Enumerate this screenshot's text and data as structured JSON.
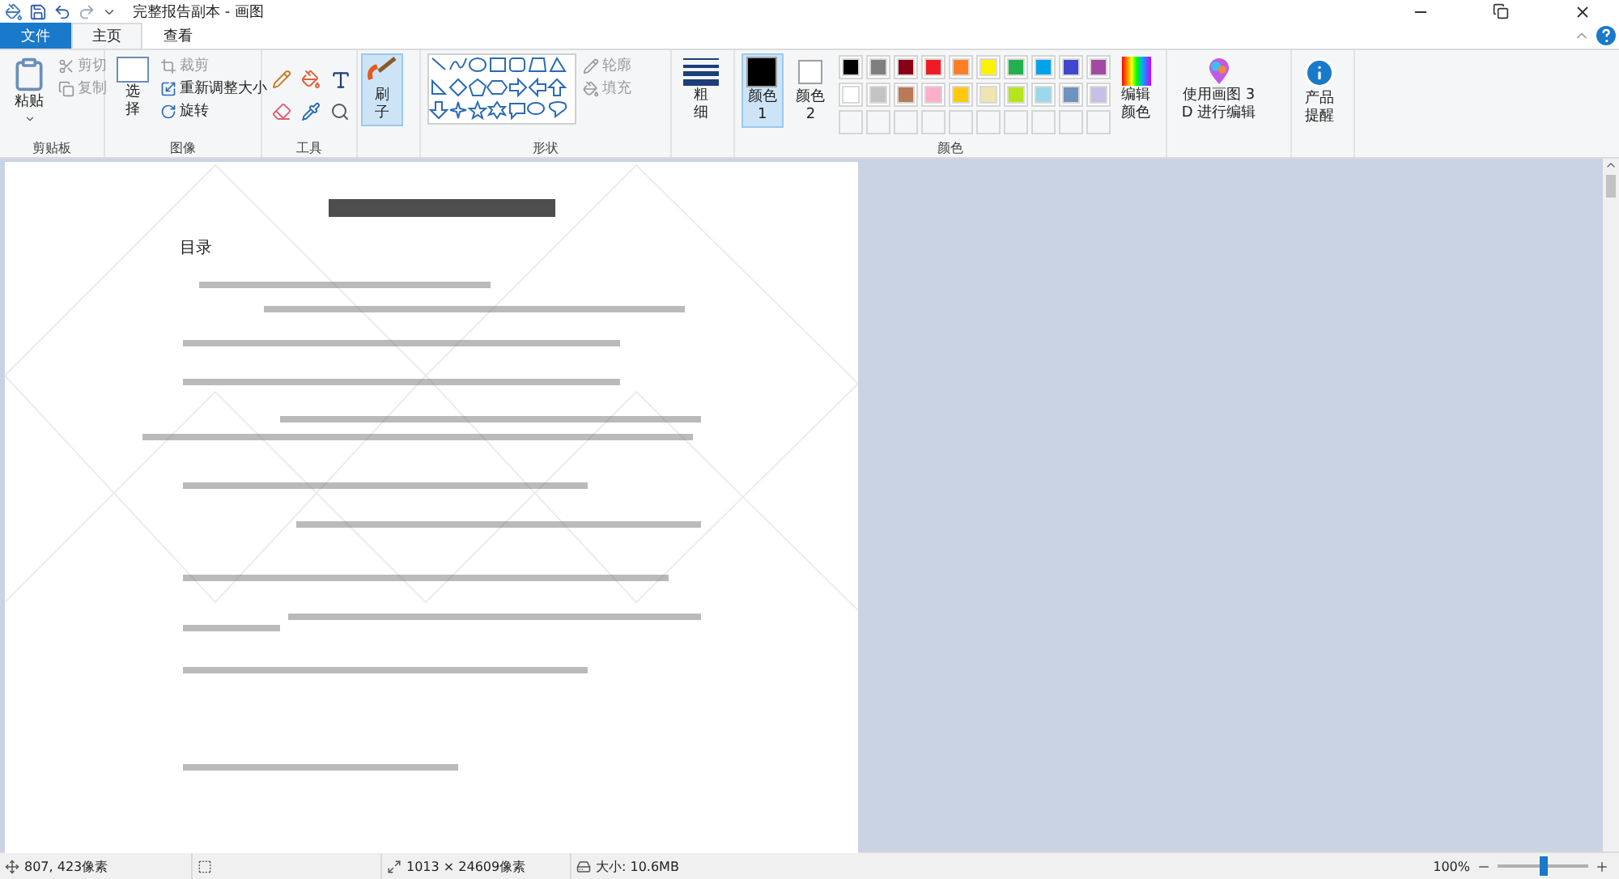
{
  "window": {
    "title": "完整报告副本 - 画图"
  },
  "tabs": [
    {
      "label": "文件",
      "kind": "file",
      "selected": false
    },
    {
      "label": "主页",
      "kind": "tab",
      "selected": true
    },
    {
      "label": "查看",
      "kind": "tab",
      "selected": false
    }
  ],
  "ribbon": {
    "clipboard": {
      "label": "剪贴板",
      "paste": "粘贴",
      "cut": {
        "label": "剪切",
        "disabled": true
      },
      "copy": {
        "label": "复制",
        "disabled": true
      }
    },
    "image": {
      "label": "图像",
      "select": "选择",
      "crop": {
        "label": "裁剪",
        "disabled": true
      },
      "resize": {
        "label": "重新调整大小",
        "disabled": false
      },
      "rotate": {
        "label": "旋转",
        "disabled": false
      }
    },
    "tools": {
      "label": "工具"
    },
    "brushes": {
      "label": "刷子",
      "selected": true
    },
    "shapes": {
      "label": "形状",
      "outline": {
        "label": "轮廓",
        "disabled": true
      },
      "fill": {
        "label": "填充",
        "disabled": true
      }
    },
    "size": {
      "label": "粗细"
    },
    "colors": {
      "label": "颜色",
      "color1": {
        "label": "颜色 1",
        "color": "#000000",
        "selected": true
      },
      "color2": {
        "label": "颜色 2",
        "color": "#ffffff",
        "selected": false
      },
      "palette": [
        {
          "color": "#000000"
        },
        {
          "color": "#7f7f7f"
        },
        {
          "color": "#880015"
        },
        {
          "color": "#ed1c24"
        },
        {
          "color": "#ff7f27"
        },
        {
          "color": "#fff200"
        },
        {
          "color": "#22b14c"
        },
        {
          "color": "#00a2e8"
        },
        {
          "color": "#3f48cc"
        },
        {
          "color": "#a349a4"
        },
        {
          "color": "#ffffff"
        },
        {
          "color": "#c3c3c3"
        },
        {
          "color": "#b97a57"
        },
        {
          "color": "#ffaec9"
        },
        {
          "color": "#ffc90e"
        },
        {
          "color": "#efe4b0"
        },
        {
          "color": "#b5e61d"
        },
        {
          "color": "#99d9ea"
        },
        {
          "color": "#7092be"
        },
        {
          "color": "#c8bfe7"
        }
      ],
      "edit": "编辑颜色"
    },
    "paint3d": "使用画图 3 D 进行编辑",
    "product": "产品提醒"
  },
  "canvas": {
    "heading": "目录"
  },
  "status_bar": {
    "cursor": "807, 423像素",
    "dimensions": "1013 × 24609像素",
    "size": "大小: 10.6MB",
    "zoom": "100%",
    "zoom_slider": {
      "level": 0.5
    }
  }
}
